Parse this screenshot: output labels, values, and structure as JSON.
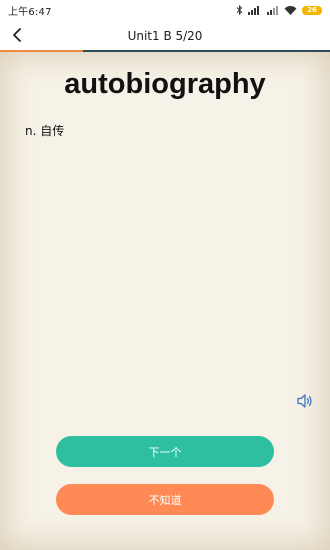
{
  "status_bar": {
    "time": "上午6:47",
    "battery": "26"
  },
  "header": {
    "title": "Unit1 B 5/20",
    "progress": 0.25
  },
  "card": {
    "word": "autobiography",
    "definition": "n. 自传"
  },
  "actions": {
    "next_label": "下一个",
    "unknown_label": "不知道"
  },
  "colors": {
    "background": "#f7f2e7",
    "progress_accent": "#f08a3c",
    "progress_track": "#2e4a5a",
    "next_button": "#2dbf9f",
    "unknown_button": "#ff8a55",
    "speaker": "#3b73c7"
  },
  "icons": {
    "back": "chevron-left-icon",
    "speaker": "speaker-icon",
    "bluetooth": "bluetooth-icon",
    "signal": "signal-icon",
    "wifi": "wifi-icon",
    "battery": "battery-icon"
  }
}
